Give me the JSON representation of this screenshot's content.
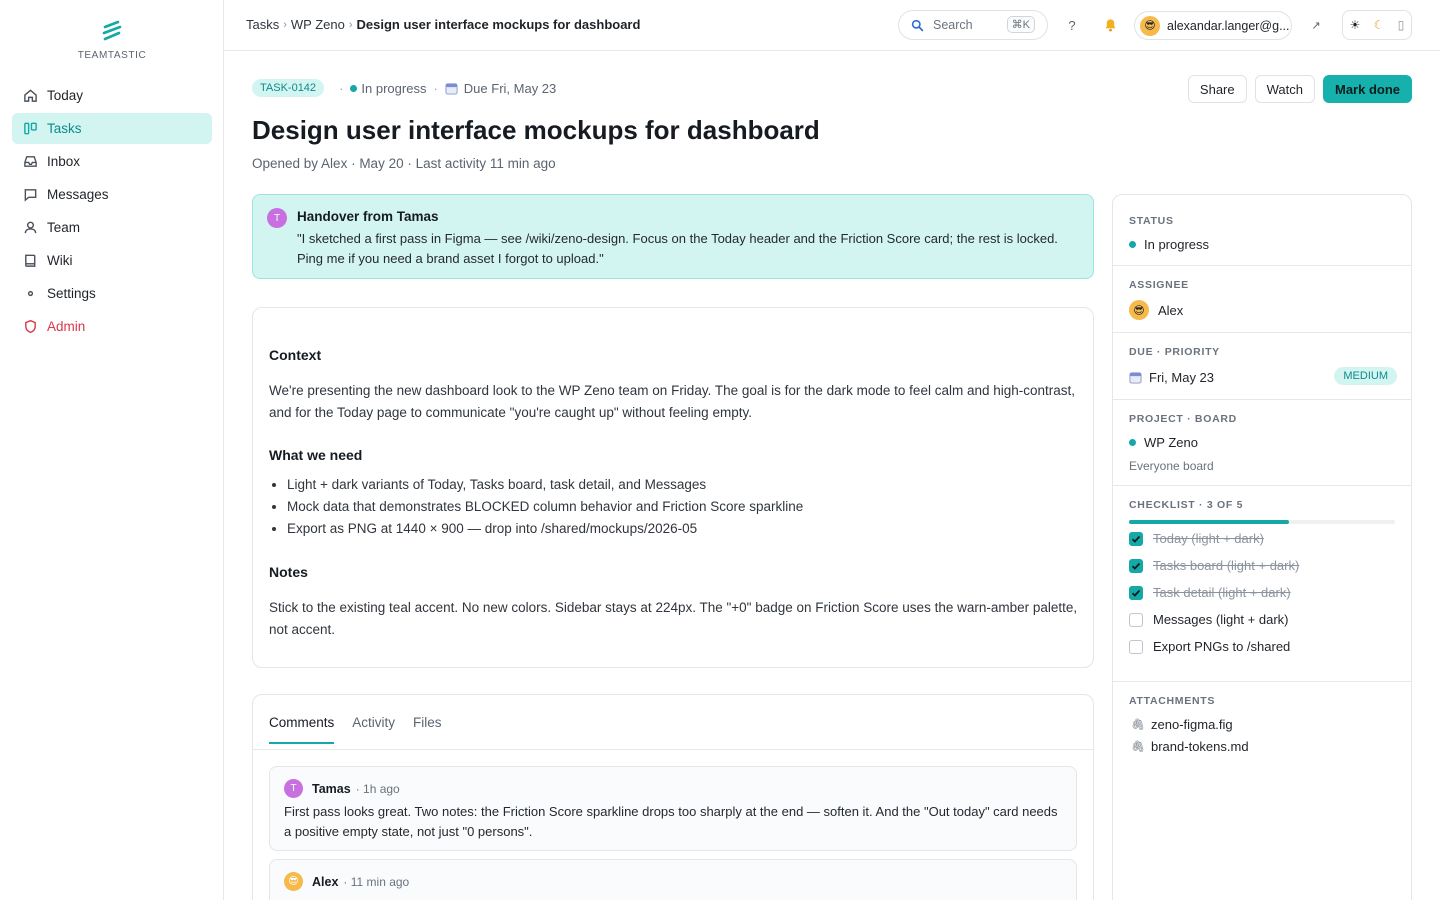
{
  "app": {
    "brand": "TEAMTASTIC"
  },
  "colors": {
    "accent": "#14a8a6",
    "accent_soft": "#d3f5f2",
    "danger": "#d93848"
  },
  "sidebar": {
    "items": [
      {
        "label": "Today",
        "icon": "home-icon"
      },
      {
        "label": "Tasks",
        "icon": "board-icon"
      },
      {
        "label": "Inbox",
        "icon": "inbox-icon"
      },
      {
        "label": "Messages",
        "icon": "message-icon"
      },
      {
        "label": "Team",
        "icon": "user-icon"
      },
      {
        "label": "Wiki",
        "icon": "book-icon"
      },
      {
        "label": "Settings",
        "icon": "dot-icon"
      },
      {
        "label": "Admin",
        "icon": "shield-icon"
      }
    ]
  },
  "topbar": {
    "breadcrumb": [
      "Tasks",
      "WP Zeno",
      "Design user interface mockups for dashboard"
    ],
    "search": {
      "placeholder": "Search",
      "shortcut": "⌘K"
    },
    "user_email": "alexandar.langer@g..."
  },
  "task": {
    "id": "TASK-0142",
    "status": "In progress",
    "due": "Due Fri, May 23",
    "title": "Design user interface mockups for dashboard",
    "subtitle": "Opened by Alex · May 20 · Last activity 11 min ago",
    "actions": {
      "share": "Share",
      "watch": "Watch",
      "done": "Mark done"
    }
  },
  "handover": {
    "initial": "T",
    "title": "Handover from Tamas",
    "text": "\"I sketched a first pass in Figma — see /wiki/zeno-design. Focus on the Today header and the Friction Score card; the rest is locked. Ping me if you need a brand asset I forgot to upload.\""
  },
  "description": {
    "context_heading": "Context",
    "context_text": "We're presenting the new dashboard look to the WP Zeno team on Friday. The goal is for the dark mode to feel calm and high-contrast, and for the Today page to communicate \"you're caught up\" without feeling empty.",
    "need_heading": "What we need",
    "needs": [
      "Light + dark variants of Today, Tasks board, task detail, and Messages",
      "Mock data that demonstrates BLOCKED column behavior and Friction Score sparkline",
      "Export as PNG at 1440 × 900 — drop into /shared/mockups/2026-05"
    ],
    "notes_heading": "Notes",
    "notes_text": "Stick to the existing teal accent. No new colors. Sidebar stays at 224px. The \"+0\" badge on Friction Score uses the warn-amber palette, not accent."
  },
  "comments": {
    "tabs": [
      "Comments",
      "Activity",
      "Files"
    ],
    "items": [
      {
        "initial": "T",
        "author": "Tamas",
        "time": "· 1h ago",
        "text": "First pass looks great. Two notes: the Friction Score sparkline drops too sharply at the end — soften it. And the \"Out today\" card needs a positive empty state, not just \"0 persons\"."
      },
      {
        "initial": "",
        "author": "Alex",
        "time": "· 11 min ago",
        "text": ""
      }
    ]
  },
  "panel": {
    "status_label": "STATUS",
    "status_value": "In progress",
    "assignee_label": "ASSIGNEE",
    "assignee_value": "Alex",
    "due_label": "DUE · PRIORITY",
    "due_value": "Fri, May 23",
    "priority": "MEDIUM",
    "project_label": "PROJECT · BOARD",
    "project_value": "WP Zeno",
    "board_value": "Everyone board",
    "checklist_label": "CHECKLIST · 3 OF 5",
    "checklist_progress": 0.6,
    "checklist": [
      {
        "label": "Today (light + dark)",
        "done": true
      },
      {
        "label": "Tasks board (light + dark)",
        "done": true
      },
      {
        "label": "Task detail (light + dark)",
        "done": true
      },
      {
        "label": "Messages (light + dark)",
        "done": false
      },
      {
        "label": "Export PNGs to /shared",
        "done": false
      }
    ],
    "attachments_label": "ATTACHMENTS",
    "attachments": [
      "zeno-figma.fig",
      "brand-tokens.md"
    ]
  }
}
